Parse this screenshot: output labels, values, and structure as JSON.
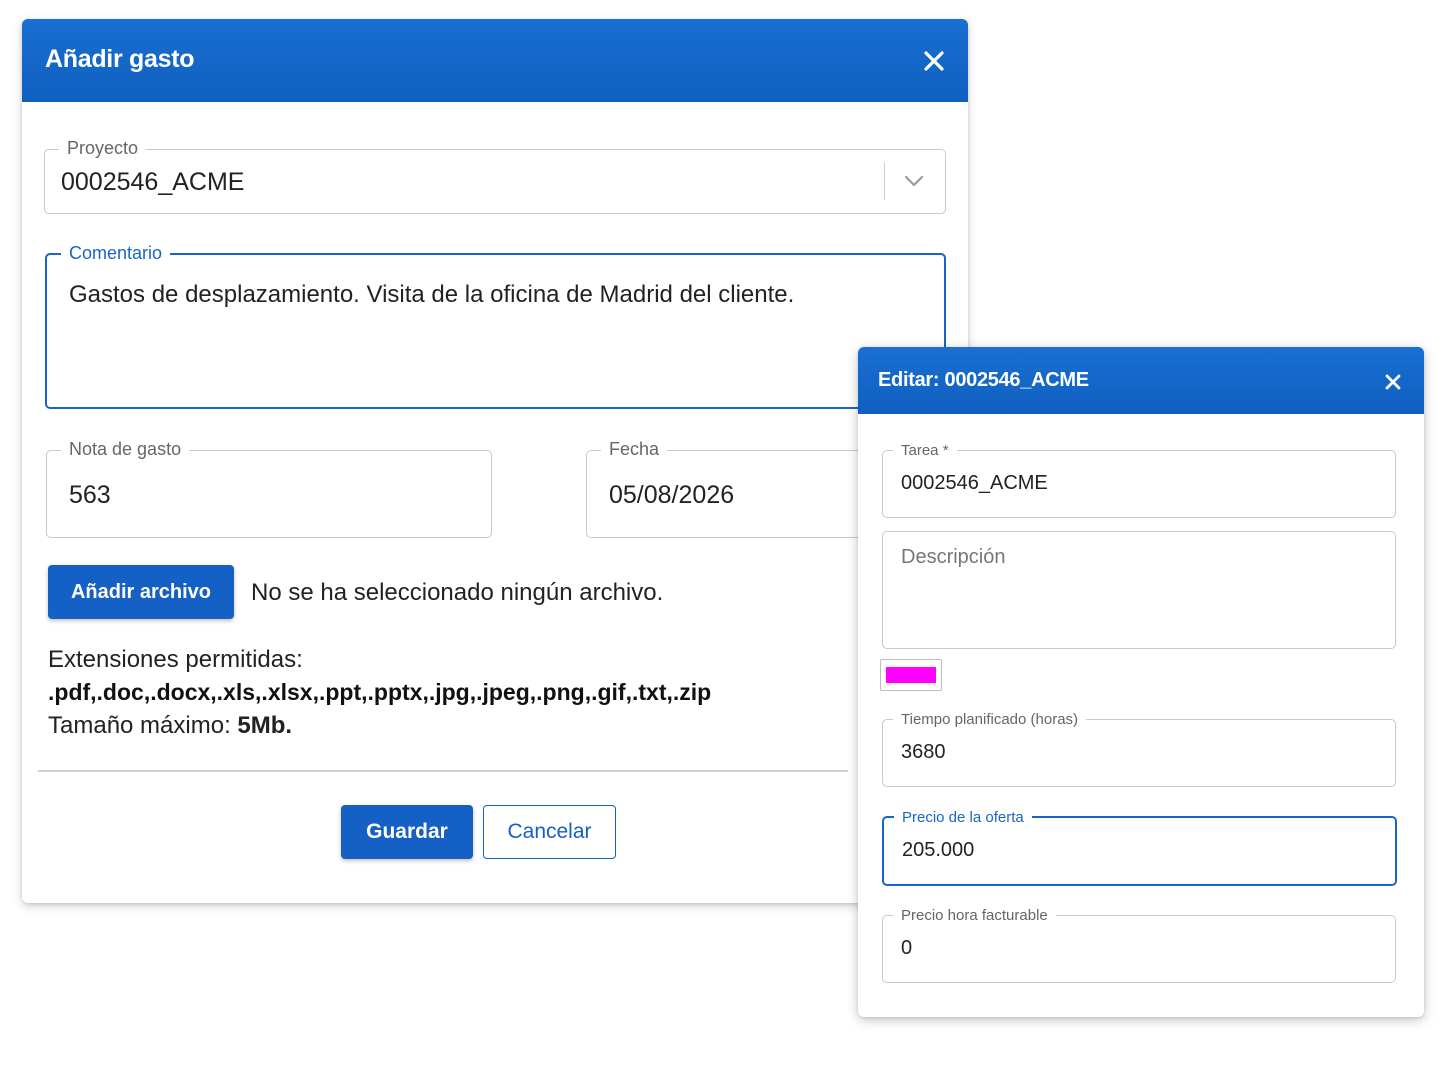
{
  "expense_dialog": {
    "title": "Añadir gasto",
    "project": {
      "label": "Proyecto",
      "value": "0002546_ACME"
    },
    "comment": {
      "label": "Comentario",
      "value": "Gastos de desplazamiento. Visita de la oficina de Madrid del cliente."
    },
    "expense_note": {
      "label": "Nota de gasto",
      "value": "563"
    },
    "date": {
      "label": "Fecha",
      "value": "05/08/2026"
    },
    "add_file_button": "Añadir archivo",
    "file_status": "No se ha seleccionado ningún archivo.",
    "extensions_label": "Extensiones permitidas:",
    "extensions_value": ".pdf,.doc,.docx,.xls,.xlsx,.ppt,.pptx,.jpg,.jpeg,.png,.gif,.txt,.zip",
    "max_size_label": "Tamaño máximo: ",
    "max_size_value": "5Mb.",
    "save_button": "Guardar",
    "cancel_button": "Cancelar",
    "icons": {
      "close": "close-icon",
      "dropdown": "chevron-down-icon"
    }
  },
  "edit_dialog": {
    "title": "Editar: 0002546_ACME",
    "task": {
      "label": "Tarea *",
      "value": "0002546_ACME"
    },
    "description": {
      "placeholder": "Descripción"
    },
    "color": {
      "value": "#ff00ff"
    },
    "planned_time": {
      "label": "Tiempo planificado (horas)",
      "value": "3680"
    },
    "offer_price": {
      "label": "Precio de la oferta",
      "value": "205.000"
    },
    "billable_rate": {
      "label": "Precio hora facturable",
      "value": "0"
    },
    "icons": {
      "close": "close-icon"
    }
  },
  "colors": {
    "header_blue": "#1560c4",
    "focus_blue": "#1a64c8"
  }
}
